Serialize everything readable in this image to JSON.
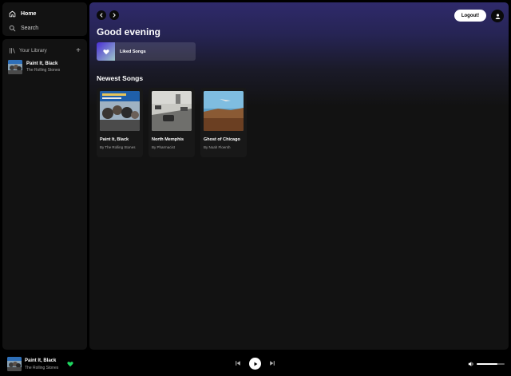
{
  "nav": {
    "items": [
      {
        "label": "Home",
        "icon": "home-icon"
      },
      {
        "label": "Search",
        "icon": "search-icon"
      }
    ]
  },
  "library": {
    "title": "Your Library",
    "add_icon": "+",
    "items": [
      {
        "title": "Paint It, Black",
        "artist": "The Rolling Stones"
      }
    ]
  },
  "header": {
    "logout_label": "Logout!"
  },
  "main": {
    "greeting": "Good evening",
    "liked_label": "Liked Songs",
    "section_title": "Newest Songs",
    "cards": [
      {
        "title": "Paint It, Black",
        "subtitle": "By The Rolling Stones"
      },
      {
        "title": "North Memphis",
        "subtitle": "By Pharmacist"
      },
      {
        "title": "Ghost of Chicago",
        "subtitle": "By Noah Floersh"
      }
    ]
  },
  "player": {
    "title": "Paint It, Black",
    "artist": "The Rolling Stones",
    "volume": 0.75
  },
  "colors": {
    "accent": "#1ed760",
    "background": "#121212"
  }
}
